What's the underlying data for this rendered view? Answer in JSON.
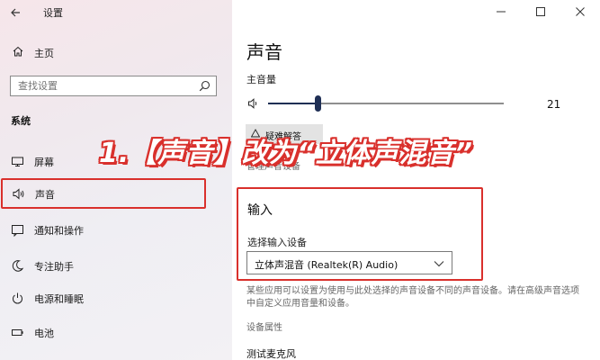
{
  "app": {
    "title": "设置"
  },
  "window_controls": [
    "minimize",
    "maximize",
    "close"
  ],
  "sidebar": {
    "home_label": "主页",
    "search_placeholder": "查找设置",
    "group_heading": "系统",
    "items": [
      {
        "label": "屏幕",
        "icon": "monitor-icon",
        "selected": false
      },
      {
        "label": "声音",
        "icon": "speaker-icon",
        "selected": true
      },
      {
        "label": "通知和操作",
        "icon": "notification-icon",
        "selected": false
      },
      {
        "label": "专注助手",
        "icon": "moon-icon",
        "selected": false
      },
      {
        "label": "电源和睡眠",
        "icon": "power-icon",
        "selected": false
      },
      {
        "label": "电池",
        "icon": "battery-icon",
        "selected": false
      }
    ]
  },
  "main": {
    "title": "声音",
    "master_volume_label": "主音量",
    "volume": {
      "value": 21,
      "level_fraction": 0.21,
      "display": "21"
    },
    "troubleshoot_label": "疑难解答",
    "manage_devices_label": "管理声音设备",
    "input": {
      "title": "输入",
      "select_label": "选择输入设备",
      "selected_device": "立体声混音 (Realtek(R) Audio)",
      "hint": "某些应用可以设置为使用与此处选择的声音设备不同的声音设备。请在高级声音选项中自定义应用音量和设备。",
      "properties_label": "设备属性",
      "test_mic_label": "测试麦克风"
    }
  },
  "annotation": {
    "text": "1.【声音】改为“立体声混音”",
    "color": "#d9302c"
  }
}
